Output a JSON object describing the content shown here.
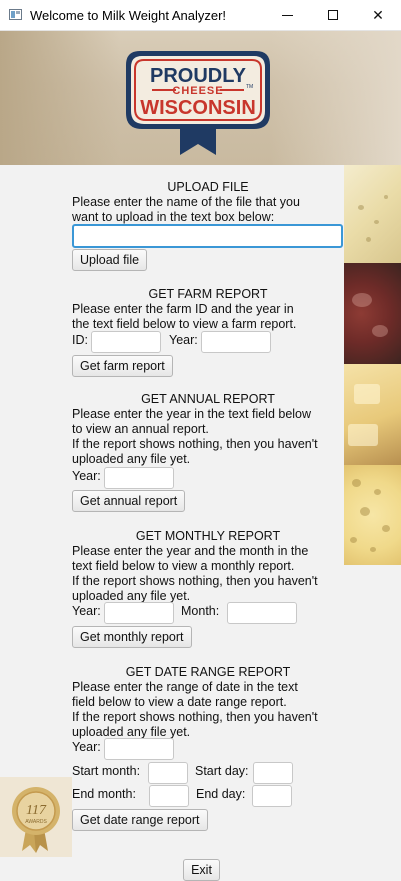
{
  "window": {
    "title": "Welcome to Milk Weight Analyzer!",
    "controls": [
      "minimize",
      "maximize",
      "close"
    ]
  },
  "banner": {
    "logo_line1": "PROUDLY",
    "logo_line2": "CHEESE",
    "logo_line3": "WISCONSIN",
    "tm": "TM"
  },
  "upload": {
    "heading": "UPLOAD FILE",
    "line1": "Please enter the name of the file that you",
    "line2": "want to upload in the text box below:",
    "input_value": "",
    "button": "Upload file"
  },
  "farm": {
    "heading": "GET FARM REPORT",
    "line1": "Please enter the farm ID and the year in",
    "line2": "the text field below to view a farm report.",
    "id_label": "ID:",
    "year_label": "Year:",
    "button": "Get farm report"
  },
  "annual": {
    "heading": "GET ANNUAL REPORT",
    "line1": "Please enter the year in the text field below",
    "line2": "to view an annual report.",
    "line3": "If the report shows nothing, then you haven't",
    "line4": "uploaded any file yet.",
    "year_label": "Year:",
    "button": "Get annual report"
  },
  "monthly": {
    "heading": "GET MONTHLY REPORT",
    "line1": "Please enter the year and the month in the",
    "line2": "text field below to view a monthly report.",
    "line3": "If the report shows nothing, then you haven't",
    "line4": "uploaded any file yet.",
    "year_label": "Year:",
    "month_label": "Month:",
    "button": "Get monthly report"
  },
  "daterange": {
    "heading": "GET DATE RANGE REPORT",
    "line1": "Please enter the range of date in the text",
    "line2": "field below to view a date range report.",
    "line3": "If the report shows nothing, then you haven't",
    "line4": "uploaded any file yet.",
    "year_label": "Year:",
    "start_month_label": "Start month:",
    "start_day_label": "Start day:",
    "end_month_label": "End month:",
    "end_day_label": "End day:",
    "button": "Get date range report"
  },
  "badge": {
    "number": "117",
    "text": "AWARDS"
  },
  "exit_button": "Exit",
  "colors": {
    "focus_border": "#3a97d6",
    "logo_red": "#c8362c",
    "logo_navy": "#1f3a63"
  }
}
